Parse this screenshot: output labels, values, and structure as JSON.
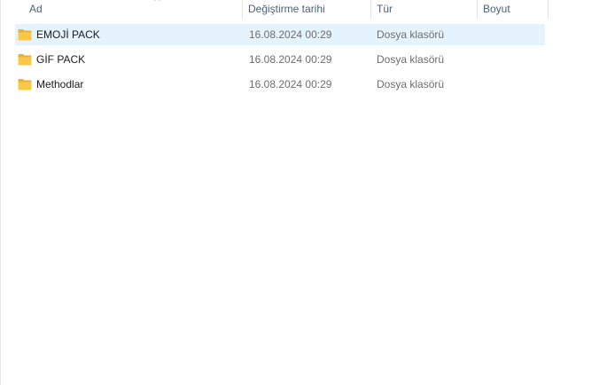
{
  "columns": {
    "name": "Ad",
    "date": "Değiştirme tarihi",
    "type": "Tür",
    "size": "Boyut"
  },
  "rows": [
    {
      "name": "EMOJİ PACK",
      "date": "16.08.2024 00:29",
      "type": "Dosya klasörü",
      "size": "",
      "icon": "folder-icon",
      "selected": true
    },
    {
      "name": "GİF PACK",
      "date": "16.08.2024 00:29",
      "type": "Dosya klasörü",
      "size": "",
      "icon": "folder-icon",
      "selected": false
    },
    {
      "name": "Methodlar",
      "date": "16.08.2024 00:29",
      "type": "Dosya klasörü",
      "size": "",
      "icon": "folder-icon",
      "selected": false
    }
  ],
  "colors": {
    "selection": "#e5f3ff",
    "folder": "#f8c948",
    "header_text": "#4c607a"
  }
}
